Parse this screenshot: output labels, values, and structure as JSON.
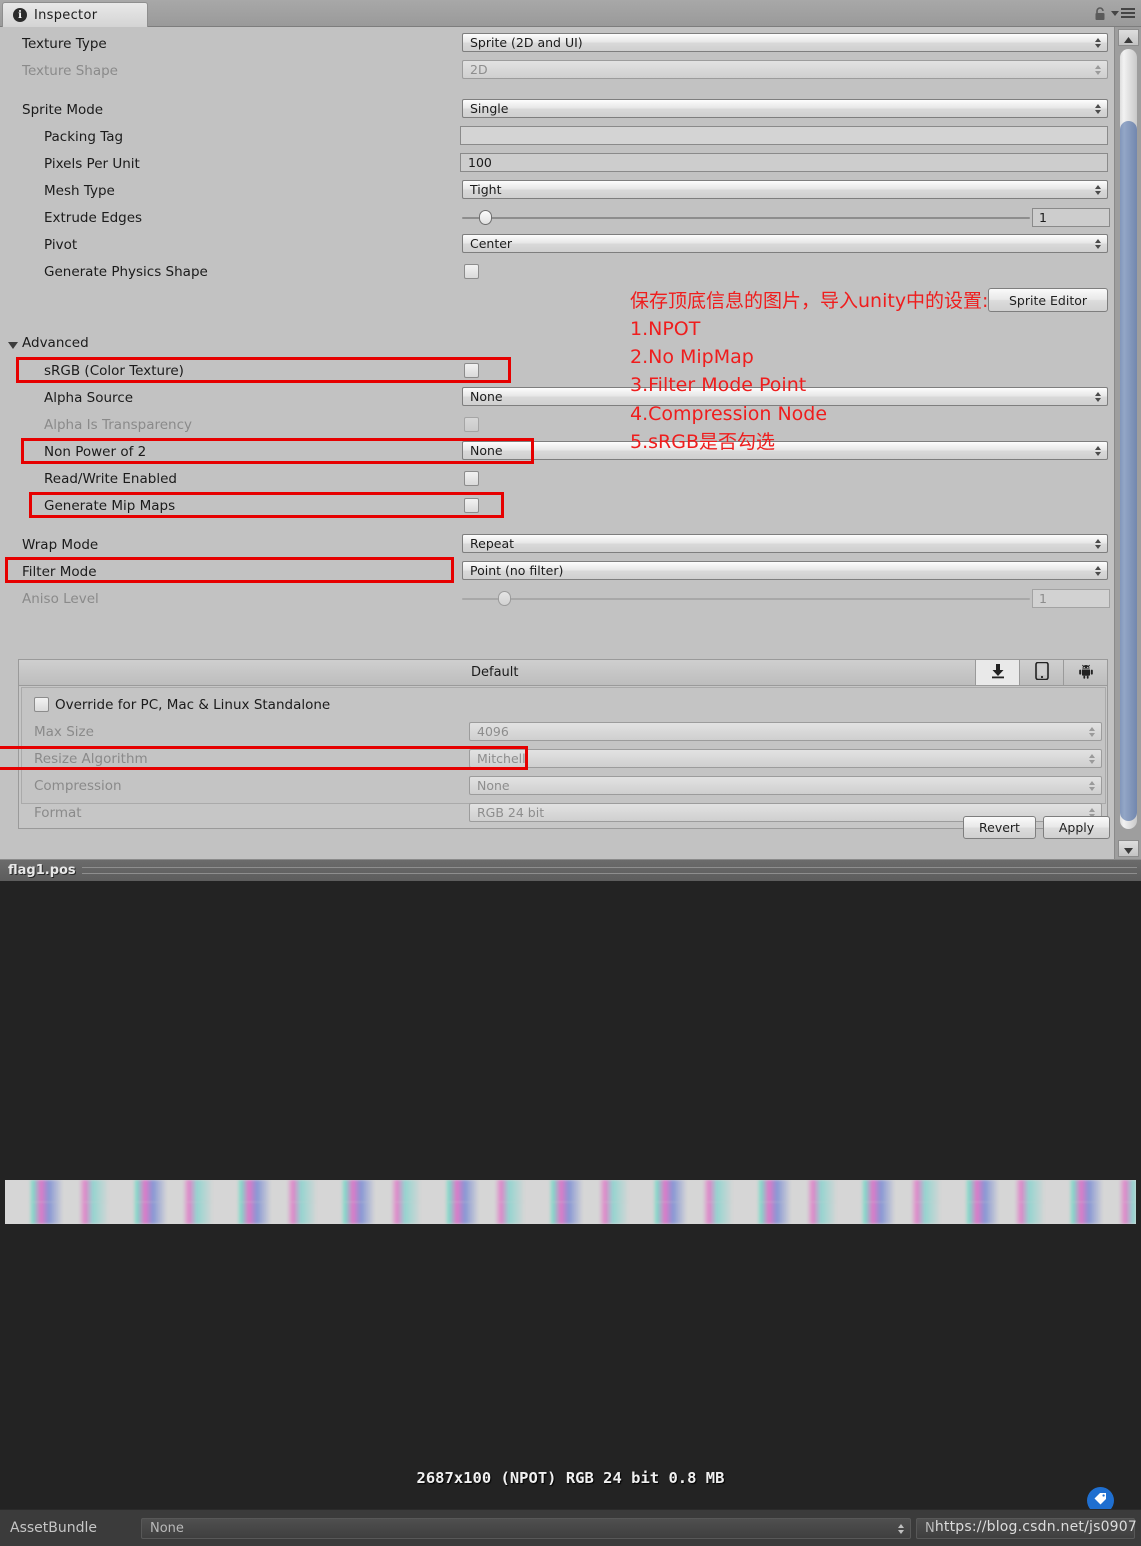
{
  "window": {
    "tab_label": "Inspector",
    "tab_icon": "info-icon",
    "lock_icon": "lock-icon",
    "menu_icon": "hamburger-menu-icon"
  },
  "inspector": {
    "fields": [
      {
        "label": "Texture Type",
        "value": "Sprite (2D and UI)",
        "type": "dropdown",
        "disabled": false
      },
      {
        "label": "Texture Shape",
        "value": "2D",
        "type": "dropdown",
        "disabled": true
      },
      {
        "label": "Sprite Mode",
        "value": "Single",
        "type": "dropdown",
        "disabled": false
      },
      {
        "label": "Packing Tag",
        "value": "",
        "type": "text",
        "disabled": false
      },
      {
        "label": "Pixels Per Unit",
        "value": "100",
        "type": "text",
        "disabled": false
      },
      {
        "label": "Mesh Type",
        "value": "Tight",
        "type": "dropdown",
        "disabled": false
      },
      {
        "label": "Extrude Edges",
        "value": "1",
        "type": "slider",
        "disabled": false
      },
      {
        "label": "Pivot",
        "value": "Center",
        "type": "dropdown",
        "disabled": false
      },
      {
        "label": "Generate Physics Shape",
        "value": "",
        "type": "checkbox",
        "disabled": false
      }
    ],
    "sprite_editor_button": "Sprite Editor",
    "advanced": {
      "header": "Advanced",
      "fields": [
        {
          "label": "sRGB (Color Texture)",
          "value": "",
          "type": "checkbox",
          "disabled": false
        },
        {
          "label": "Alpha Source",
          "value": "None",
          "type": "dropdown",
          "disabled": false
        },
        {
          "label": "Alpha Is Transparency",
          "value": "",
          "type": "checkbox",
          "disabled": true
        },
        {
          "label": "Non Power of 2",
          "value": "None",
          "type": "dropdown",
          "disabled": false
        },
        {
          "label": "Read/Write Enabled",
          "value": "",
          "type": "checkbox",
          "disabled": false
        },
        {
          "label": "Generate Mip Maps",
          "value": "",
          "type": "checkbox",
          "disabled": false
        }
      ]
    },
    "wrap": [
      {
        "label": "Wrap Mode",
        "value": "Repeat",
        "type": "dropdown",
        "disabled": false
      },
      {
        "label": "Filter Mode",
        "value": "Point (no filter)",
        "type": "dropdown",
        "disabled": false
      },
      {
        "label": "Aniso Level",
        "value": "1",
        "type": "slider",
        "disabled": true
      }
    ],
    "platform": {
      "default_label": "Default",
      "tabs": [
        {
          "name": "standalone-platform-tab",
          "icon": "download-arrow-icon",
          "active": true
        },
        {
          "name": "ios-platform-tab",
          "icon": "mobile-phone-icon",
          "active": false
        },
        {
          "name": "android-platform-tab",
          "icon": "android-robot-icon",
          "active": false
        }
      ],
      "override_label": "Override for PC, Mac & Linux Standalone",
      "override_checked": false,
      "fields": [
        {
          "label": "Max Size",
          "value": "4096",
          "disabled": true
        },
        {
          "label": "Resize Algorithm",
          "value": "Mitchell",
          "disabled": true
        },
        {
          "label": "Compression",
          "value": "None",
          "disabled": true
        },
        {
          "label": "Format",
          "value": "RGB 24 bit",
          "disabled": true
        }
      ]
    },
    "revert_button": "Revert",
    "apply_button": "Apply"
  },
  "annotation": {
    "color": "#ef1d1d",
    "lines": [
      "保存顶底信息的图片，导入unity中的设置:",
      "1.NPOT",
      "2.No MipMap",
      "3.Filter Mode Point",
      "4.Compression  Node",
      "5.sRGB是否勾选"
    ]
  },
  "preview": {
    "asset_name": "flag1.pos",
    "info": "2687x100 (NPOT)  RGB 24 bit   0.8 MB"
  },
  "bottom": {
    "assetbundle_label": "AssetBundle",
    "assetbundle_value": "None",
    "variant_value": "N",
    "watermark": "https://blog.csdn.net/js0907",
    "tag_badge_icon": "tag-icon"
  }
}
